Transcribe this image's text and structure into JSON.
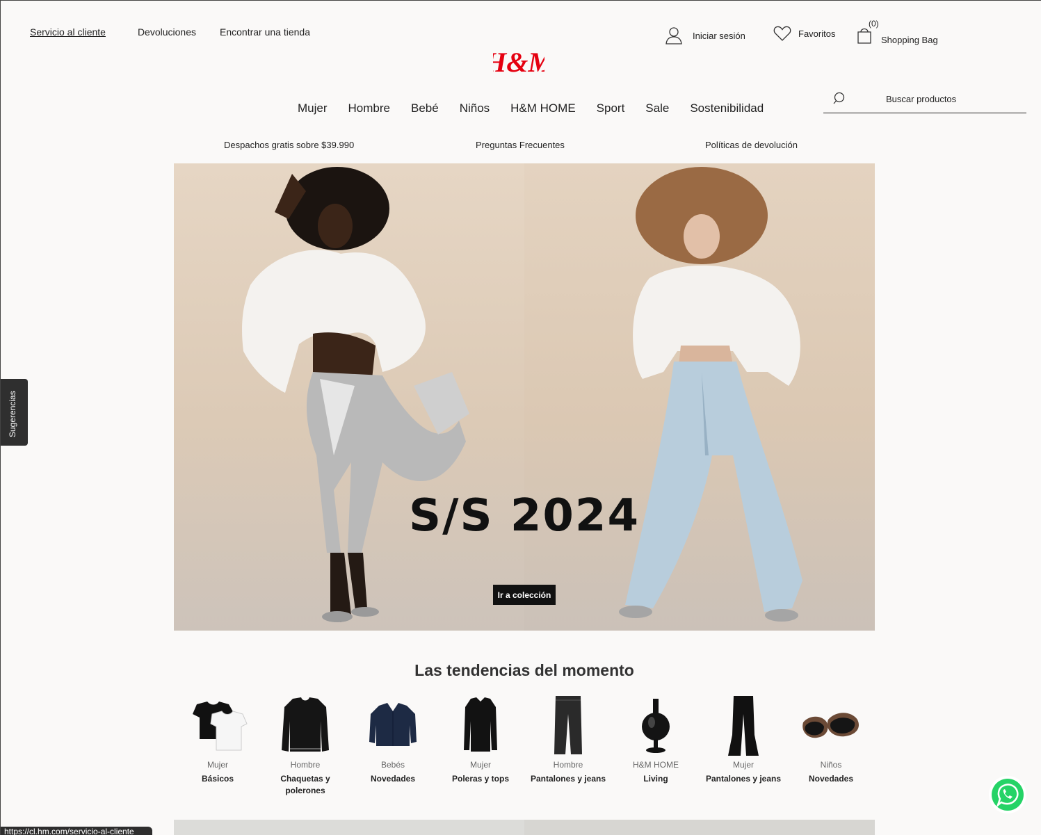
{
  "utility_links": {
    "customer_service": "Servicio al cliente",
    "returns": "Devoluciones",
    "find_store": "Encontrar una tienda"
  },
  "account": {
    "login": "Iniciar sesión",
    "favorites": "Favoritos",
    "bag_count": "(0)",
    "bag_label": "Shopping Bag"
  },
  "brand": {
    "logo": "H&M",
    "color": "#e50010"
  },
  "nav": [
    "Mujer",
    "Hombre",
    "Bebé",
    "Niños",
    "H&M HOME",
    "Sport",
    "Sale",
    "Sostenibilidad"
  ],
  "search": {
    "placeholder": "Buscar productos",
    "icon": "search-icon"
  },
  "info_strip": [
    "Despachos gratis sobre $39.990",
    "Preguntas Frecuentes",
    "Políticas de devolución"
  ],
  "hero": {
    "title": "S/S 2024",
    "cta": "Ir a colección"
  },
  "trends": {
    "title": "Las tendencias del momento",
    "items": [
      {
        "category": "Mujer",
        "name": "Básicos"
      },
      {
        "category": "Hombre",
        "name": "Chaquetas y polerones"
      },
      {
        "category": "Bebés",
        "name": "Novedades"
      },
      {
        "category": "Mujer",
        "name": "Poleras y tops"
      },
      {
        "category": "Hombre",
        "name": "Pantalones y jeans"
      },
      {
        "category": "H&M HOME",
        "name": "Living"
      },
      {
        "category": "Mujer",
        "name": "Pantalones y jeans"
      },
      {
        "category": "Niños",
        "name": "Novedades"
      }
    ]
  },
  "feedback_tab": "Sugerencias",
  "status_url": "https://cl.hm.com/servicio-al-cliente"
}
